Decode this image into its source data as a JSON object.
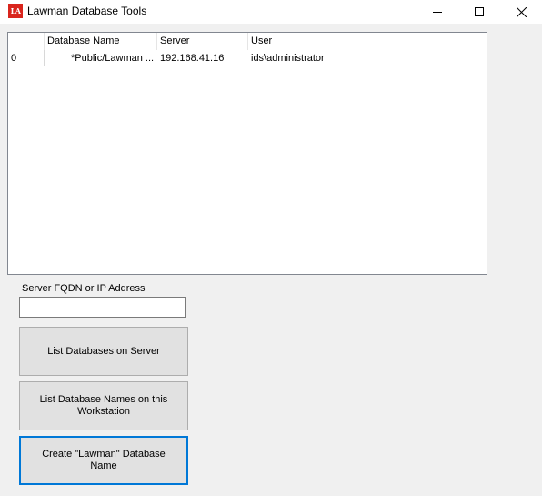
{
  "window": {
    "title": "Lawman Database Tools",
    "app_icon_text": "LA"
  },
  "listview": {
    "columns": [
      "",
      "Database Name",
      "Server",
      "User"
    ],
    "rows": [
      {
        "index": "0",
        "database_name": "*Public/Lawman ...",
        "server": "192.168.41.16",
        "user": "ids\\administrator"
      }
    ]
  },
  "form": {
    "server_label": "Server FQDN or IP Address",
    "server_value": "",
    "list_databases_label": "List Databases on Server",
    "list_workstation_label": "List Database Names on this Workstation",
    "create_label": "Create \"Lawman\" Database Name"
  },
  "colors": {
    "accent": "#0078d7",
    "icon_red": "#d9251d",
    "button_face": "#e1e1e1"
  }
}
